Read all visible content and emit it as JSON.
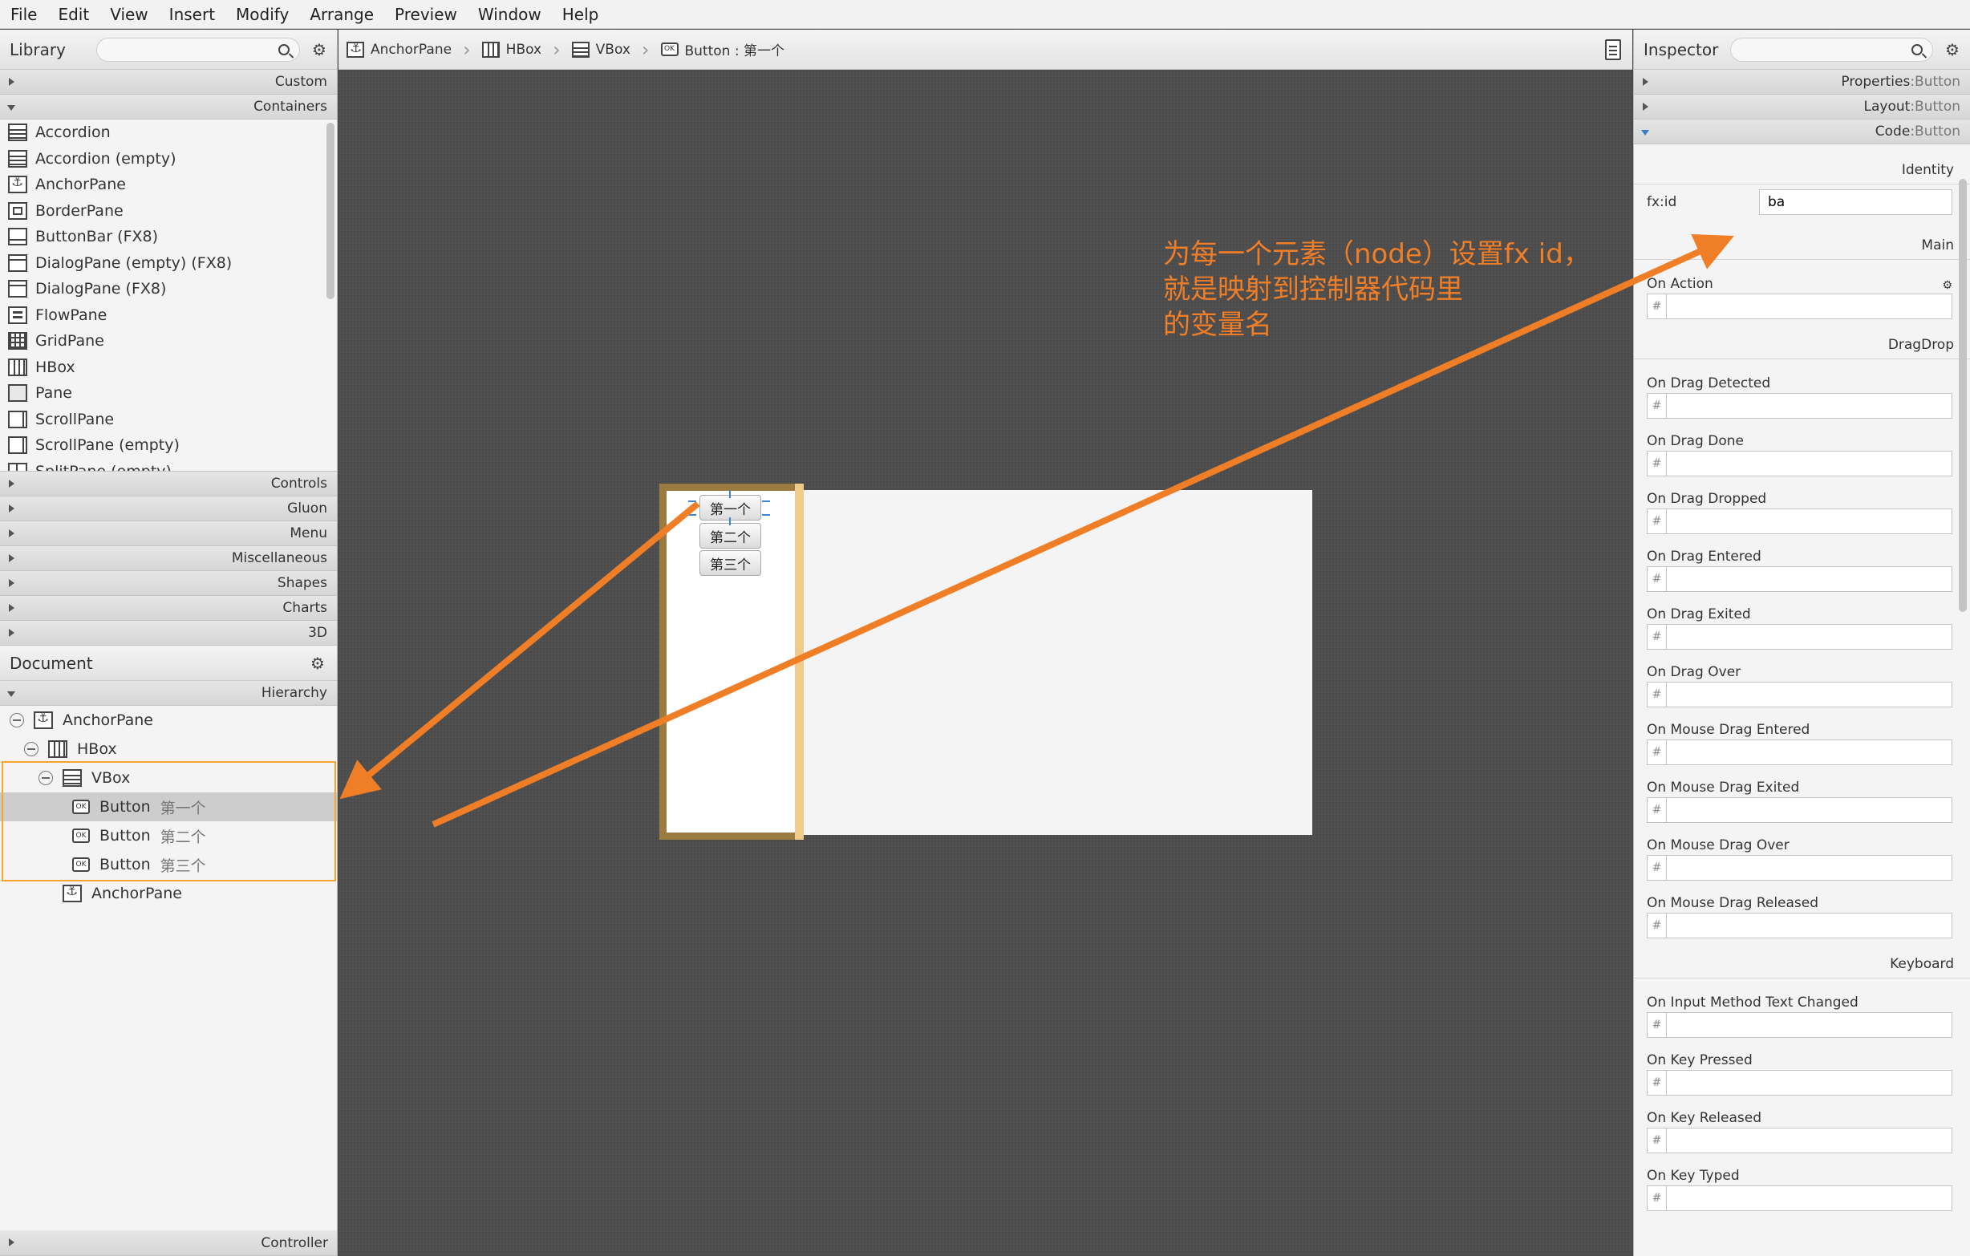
{
  "menu": [
    "File",
    "Edit",
    "View",
    "Insert",
    "Modify",
    "Arrange",
    "Preview",
    "Window",
    "Help"
  ],
  "library": {
    "title": "Library",
    "sections_top": [
      "Custom",
      "Containers"
    ],
    "items": [
      {
        "label": "Accordion",
        "icon": "accordion-icon"
      },
      {
        "label": "Accordion  (empty)",
        "icon": "accordion-icon"
      },
      {
        "label": "AnchorPane",
        "icon": "anchorpane-icon"
      },
      {
        "label": "BorderPane",
        "icon": "borderpane-icon"
      },
      {
        "label": "ButtonBar  (FX8)",
        "icon": "buttonbar-icon"
      },
      {
        "label": "DialogPane (empty)  (FX8)",
        "icon": "dialogpane-icon"
      },
      {
        "label": "DialogPane  (FX8)",
        "icon": "dialogpane-icon"
      },
      {
        "label": "FlowPane",
        "icon": "flowpane-icon"
      },
      {
        "label": "GridPane",
        "icon": "gridpane-icon"
      },
      {
        "label": "HBox",
        "icon": "hbox-icon"
      },
      {
        "label": "Pane",
        "icon": "pane-icon"
      },
      {
        "label": "ScrollPane",
        "icon": "scrollpane-icon"
      },
      {
        "label": "ScrollPane  (empty)",
        "icon": "scrollpane-icon"
      },
      {
        "label": "SplitPane  (empty)",
        "icon": "splitpane-icon"
      }
    ],
    "sections_bottom": [
      "Controls",
      "Gluon",
      "Menu",
      "Miscellaneous",
      "Shapes",
      "Charts",
      "3D"
    ]
  },
  "document": {
    "title": "Document",
    "hierarchy_label": "Hierarchy",
    "tree": [
      {
        "label": "AnchorPane",
        "sub": "",
        "indent": 0,
        "toggle": true,
        "icon": "anchorpane-icon"
      },
      {
        "label": "HBox",
        "sub": "",
        "indent": 1,
        "toggle": true,
        "icon": "hbox-icon"
      },
      {
        "label": "VBox",
        "sub": "",
        "indent": 2,
        "toggle": true,
        "icon": "vbox-icon"
      },
      {
        "label": "Button",
        "sub": "第一个",
        "indent": 3,
        "toggle": false,
        "icon": "button-icon",
        "selected": true
      },
      {
        "label": "Button",
        "sub": "第二个",
        "indent": 3,
        "toggle": false,
        "icon": "button-icon"
      },
      {
        "label": "Button",
        "sub": "第三个",
        "indent": 3,
        "toggle": false,
        "icon": "button-icon"
      },
      {
        "label": "AnchorPane",
        "sub": "",
        "indent": 2,
        "toggle": false,
        "icon": "anchorpane-icon"
      }
    ],
    "controller_label": "Controller"
  },
  "breadcrumb": [
    {
      "label": "AnchorPane",
      "icon": "anchorpane-icon"
    },
    {
      "label": "HBox",
      "icon": "hbox-icon"
    },
    {
      "label": "VBox",
      "icon": "vbox-icon"
    },
    {
      "label": "Button : 第一个",
      "icon": "button-icon"
    }
  ],
  "canvas": {
    "buttons": [
      "第一个",
      "第二个",
      "第三个"
    ],
    "annotation": "为每一个元素（node）设置fx id，\n就是映射到控制器代码里\n的变量名",
    "annotation_color": "#f07e27",
    "selection_color": "#9b7b3f"
  },
  "inspector": {
    "title": "Inspector",
    "sections": [
      {
        "key": "Properties",
        "value": "Button"
      },
      {
        "key": "Layout",
        "value": "Button"
      },
      {
        "key": "Code",
        "value": "Button"
      }
    ],
    "identity_label": "Identity",
    "fxid_label": "fx:id",
    "fxid_value": "ba",
    "groups": [
      {
        "label": "Main",
        "events": [
          "On Action"
        ]
      },
      {
        "label": "DragDrop",
        "events": [
          "On Drag Detected",
          "On Drag Done",
          "On Drag Dropped",
          "On Drag Entered",
          "On Drag Exited",
          "On Drag Over",
          "On Mouse Drag Entered",
          "On Mouse Drag Exited",
          "On Mouse Drag Over",
          "On Mouse Drag Released"
        ]
      },
      {
        "label": "Keyboard",
        "events": [
          "On Input Method Text Changed",
          "On Key Pressed",
          "On Key Released",
          "On Key Typed"
        ]
      }
    ]
  }
}
